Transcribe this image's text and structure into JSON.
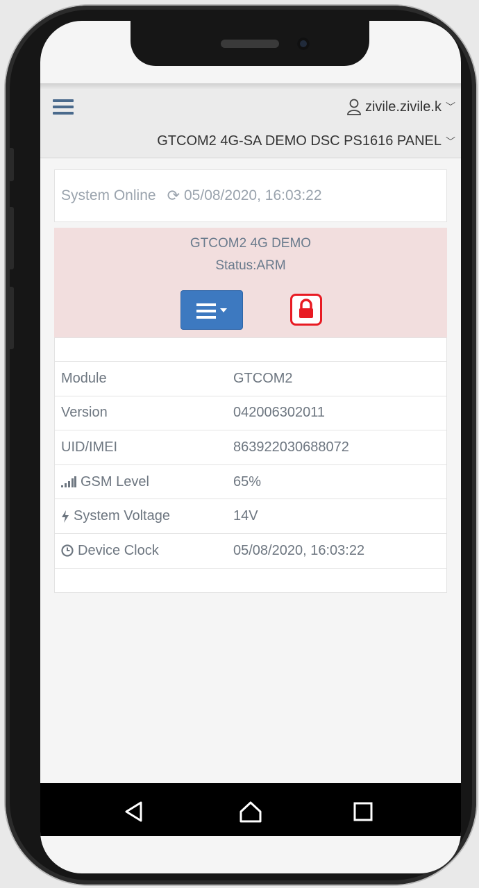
{
  "header": {
    "user": "zivile.zivile.k",
    "device": "GTCOM2 4G-SA DEMO DSC PS1616 PANEL"
  },
  "connection": {
    "status": "System Online",
    "timestamp": "05/08/2020, 16:03:22"
  },
  "panel": {
    "name": "GTCOM2 4G DEMO",
    "status": "Status:ARM",
    "background_color": "#f2dede",
    "menu_button_color": "#3d79c0",
    "lock_color": "#e81b23"
  },
  "info_rows": [
    {
      "label": "Module",
      "value": "GTCOM2",
      "icon": ""
    },
    {
      "label": "Version",
      "value": "042006302011",
      "icon": ""
    },
    {
      "label": "UID/IMEI",
      "value": "863922030688072",
      "icon": ""
    },
    {
      "label": "GSM Level",
      "value": "65%",
      "icon": "signal-icon"
    },
    {
      "label": "System Voltage",
      "value": "14V",
      "icon": "bolt-icon"
    },
    {
      "label": "Device Clock",
      "value": "05/08/2020, 16:03:22",
      "icon": "clock-icon"
    }
  ]
}
